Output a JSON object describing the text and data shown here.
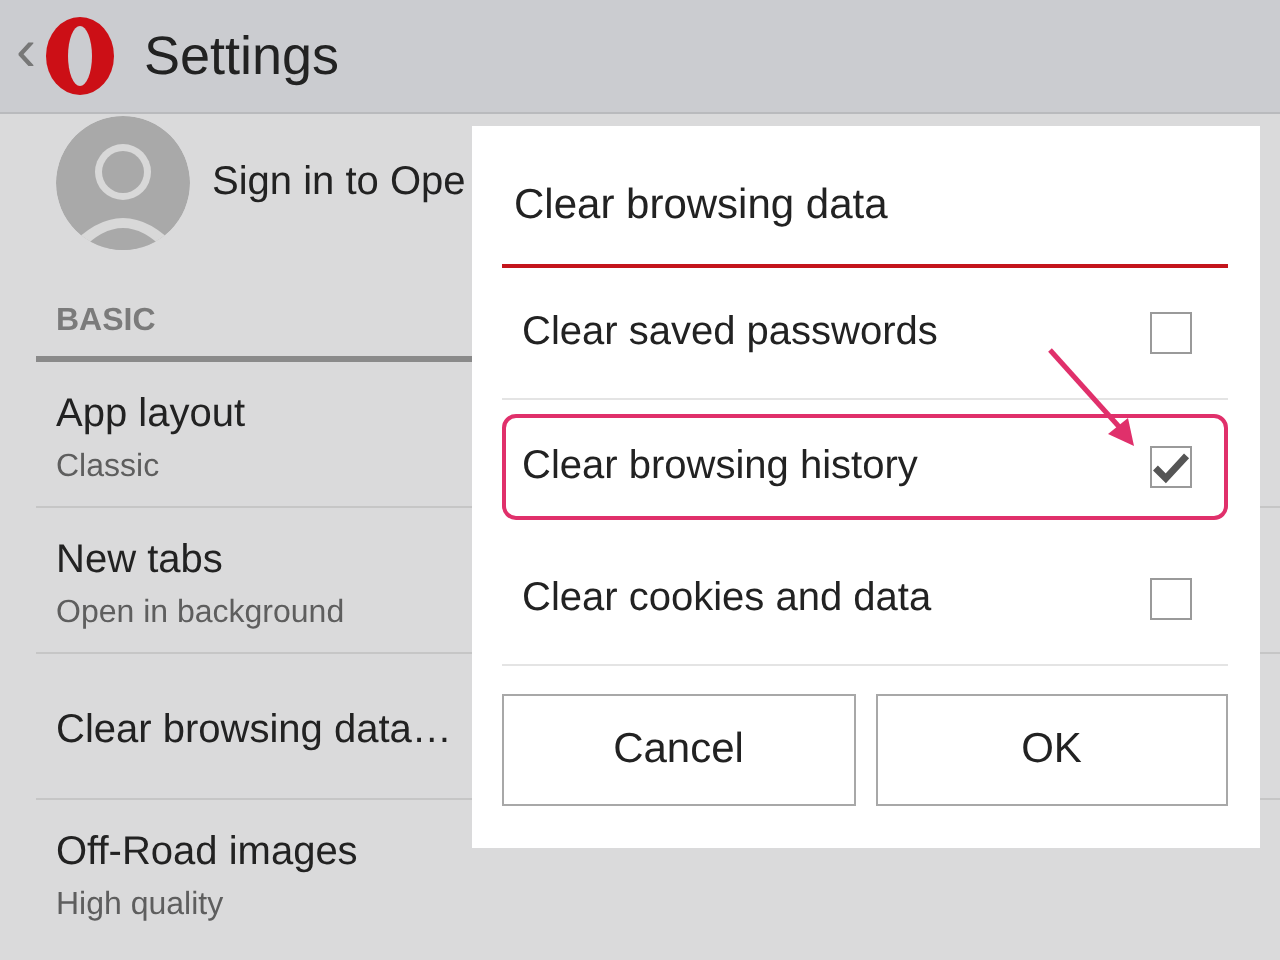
{
  "app_bar": {
    "back": "‹",
    "title": "Settings"
  },
  "account": {
    "label": "Sign in to Ope"
  },
  "section": {
    "title": "BASIC"
  },
  "settings": [
    {
      "title": "App layout",
      "value": "Classic"
    },
    {
      "title": "New tabs",
      "value": "Open in background"
    },
    {
      "title": "Clear browsing data…"
    },
    {
      "title": "Off-Road images",
      "value": "High quality"
    }
  ],
  "dialog": {
    "title": "Clear browsing data",
    "options": [
      {
        "label": "Clear saved passwords",
        "checked": false,
        "highlighted": false
      },
      {
        "label": "Clear browsing history",
        "checked": true,
        "highlighted": true
      },
      {
        "label": "Clear cookies and data",
        "checked": false,
        "highlighted": false
      }
    ],
    "buttons": [
      "Cancel",
      "OK"
    ]
  }
}
